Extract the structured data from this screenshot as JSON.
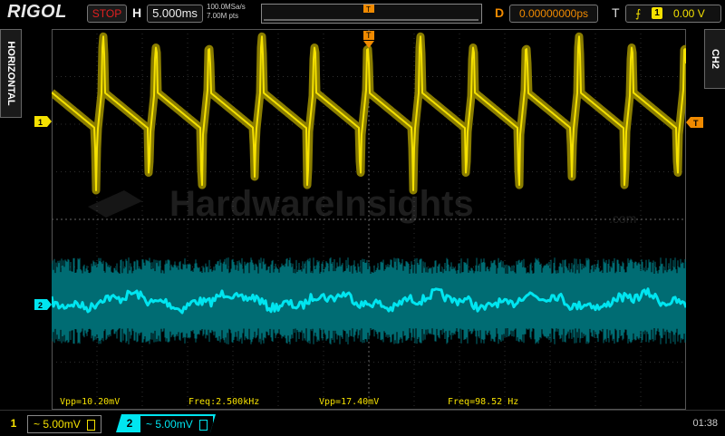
{
  "header": {
    "brand": "RIGOL",
    "run_state": "STOP",
    "horizontal_label": "H",
    "timebase": "5.000ms",
    "sample_rate": "100.0MSa/s",
    "memory_depth": "7.00M pts",
    "delay_label": "D",
    "delay": "0.00000000ps",
    "trigger_label": "T",
    "trigger_edge": "⨍",
    "trigger_source": "1",
    "trigger_level": "0.00 V"
  },
  "side": {
    "left_tab": "HORIZONTAL",
    "right_tab": "CH2"
  },
  "markers": {
    "ch1": "1",
    "ch2": "2",
    "trigger": "T"
  },
  "watermark": {
    "text": "HardwareInsights",
    "suffix": ".com"
  },
  "measurements": [
    {
      "label": "Vpp=10.20mV",
      "color": "#f5e100"
    },
    {
      "label": "Freq:2.500kHz",
      "color": "#f5e100"
    },
    {
      "label": "Vpp=17.40mV",
      "color": "#f5e100"
    },
    {
      "label": "Freq=98.52 Hz",
      "color": "#f5e100"
    }
  ],
  "channels": [
    {
      "num": "1",
      "label": "~ 5.00mV",
      "color": "#f5e100"
    },
    {
      "num": "2",
      "label": "~ 5.00mV",
      "color": "#00e5f0"
    }
  ],
  "clock": "01:38",
  "colors": {
    "ch1": "#f5e100",
    "ch2": "#00e5f0",
    "trigger": "#f08a00",
    "grid": "#3a3a3a"
  }
}
